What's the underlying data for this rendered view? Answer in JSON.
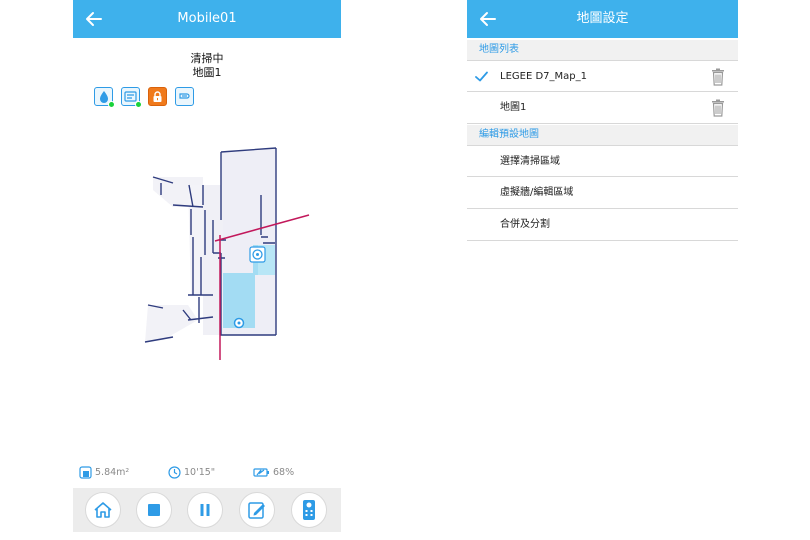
{
  "left": {
    "header": {
      "title": "Mobile01"
    },
    "status": {
      "line1": "清掃中",
      "line2": "地圖1"
    },
    "mode_icons": [
      "water-drop-icon",
      "mop-mode-icon",
      "lock-icon",
      "carpet-mode-icon"
    ],
    "stats": {
      "area": "5.84m²",
      "time": "10'15\"",
      "battery": "68%"
    },
    "toolbar": [
      "home-icon",
      "stop-icon",
      "pause-icon",
      "edit-icon",
      "remote-control-icon"
    ]
  },
  "right": {
    "header": {
      "title": "地圖設定"
    },
    "sections": [
      {
        "title": "地圖列表",
        "items": [
          {
            "label": "LEGEE D7_Map_1",
            "selected": true
          },
          {
            "label": "地圖1",
            "selected": false
          }
        ]
      },
      {
        "title": "編輯預設地圖",
        "items": [
          {
            "label": "選擇清掃區域"
          },
          {
            "label": "虛擬牆/編輯區域"
          },
          {
            "label": "合併及分割"
          }
        ]
      }
    ]
  },
  "colors": {
    "accent": "#3eb1ec",
    "section_text": "#2e9be6",
    "virtual_wall": "#c2185b",
    "room_fill": "#9fdcf2",
    "map_wall": "#2f3c7e"
  }
}
